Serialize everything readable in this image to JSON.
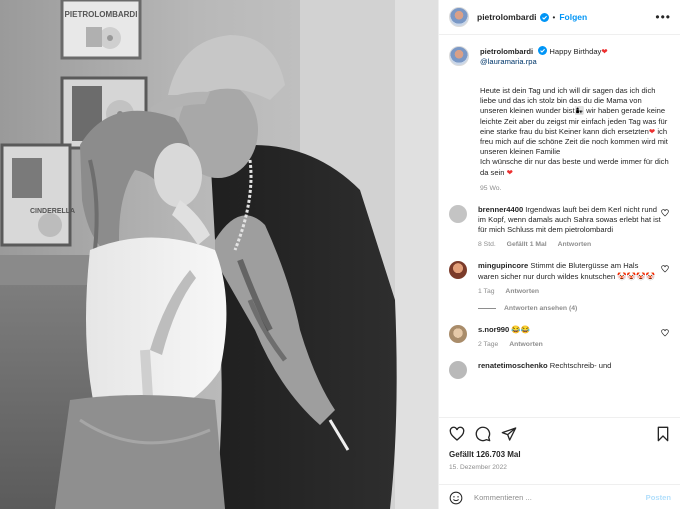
{
  "post": {
    "username": "pietrolombardi",
    "follow_label": "Folgen",
    "more_label": "•••",
    "caption": {
      "username": "pietrolombardi",
      "greeting": "Happy Birthday",
      "mention": "@lauramaria.rpa",
      "text_part1": "Heute ist dein Tag und ich will dir sagen das ich dich liebe und das ich stolz bin das du die Mama von unseren kleinen wunder bist",
      "text_part2": " wir haben gerade keine leichte Zeit aber du zeigst mir einfach jeden Tag was für eine starke frau du bist Keiner kann dich ersetzten",
      "text_part3": " ich freu mich auf die schöne Zeit die noch kommen wird mit unseren kleinen Familie\nIch wünsche dir nur das beste und werde immer für dich da sein ",
      "emoji_family": "👩‍👧",
      "emoji_heart": "❤",
      "time_ago": "95 Wo."
    },
    "comments": [
      {
        "username": "brenner4400",
        "text": "Irgendwas lauft bei dem Kerl nicht rund im Kopf, wenn damals auch Sahra sowas erlebt hat ist für mich Schluss mit dem pietrolombardi",
        "time": "8 Std.",
        "likes": "Gefällt 1 Mal",
        "reply": "Antworten"
      },
      {
        "username": "mingupincore",
        "text": "Stimmt die Blutergüsse am Hals waren sicher nur durch wildes knutschen 🤡🤡🤡🤡",
        "time": "1 Tag",
        "reply": "Antworten",
        "view_replies": "Antworten ansehen (4)"
      },
      {
        "username": "s.nor990",
        "text": "😂😂",
        "time": "2 Tage",
        "reply": "Antworten"
      },
      {
        "username": "renatetimoschenko",
        "text": "Rechtschreib- und"
      }
    ],
    "like_count": "Gefällt 126.703 Mal",
    "date": "15. Dezember 2022",
    "add_comment_placeholder": "Kommentieren ...",
    "post_label": "Posten"
  },
  "colors": {
    "accent": "#0095f6",
    "heart": "#ed2f2f",
    "muted": "#8e8e8e",
    "post_disabled": "#b2dffc"
  },
  "icons": [
    "verified-badge-icon",
    "more-options-icon",
    "heart-icon",
    "comment-icon",
    "share-icon",
    "bookmark-icon",
    "emoji-icon"
  ]
}
